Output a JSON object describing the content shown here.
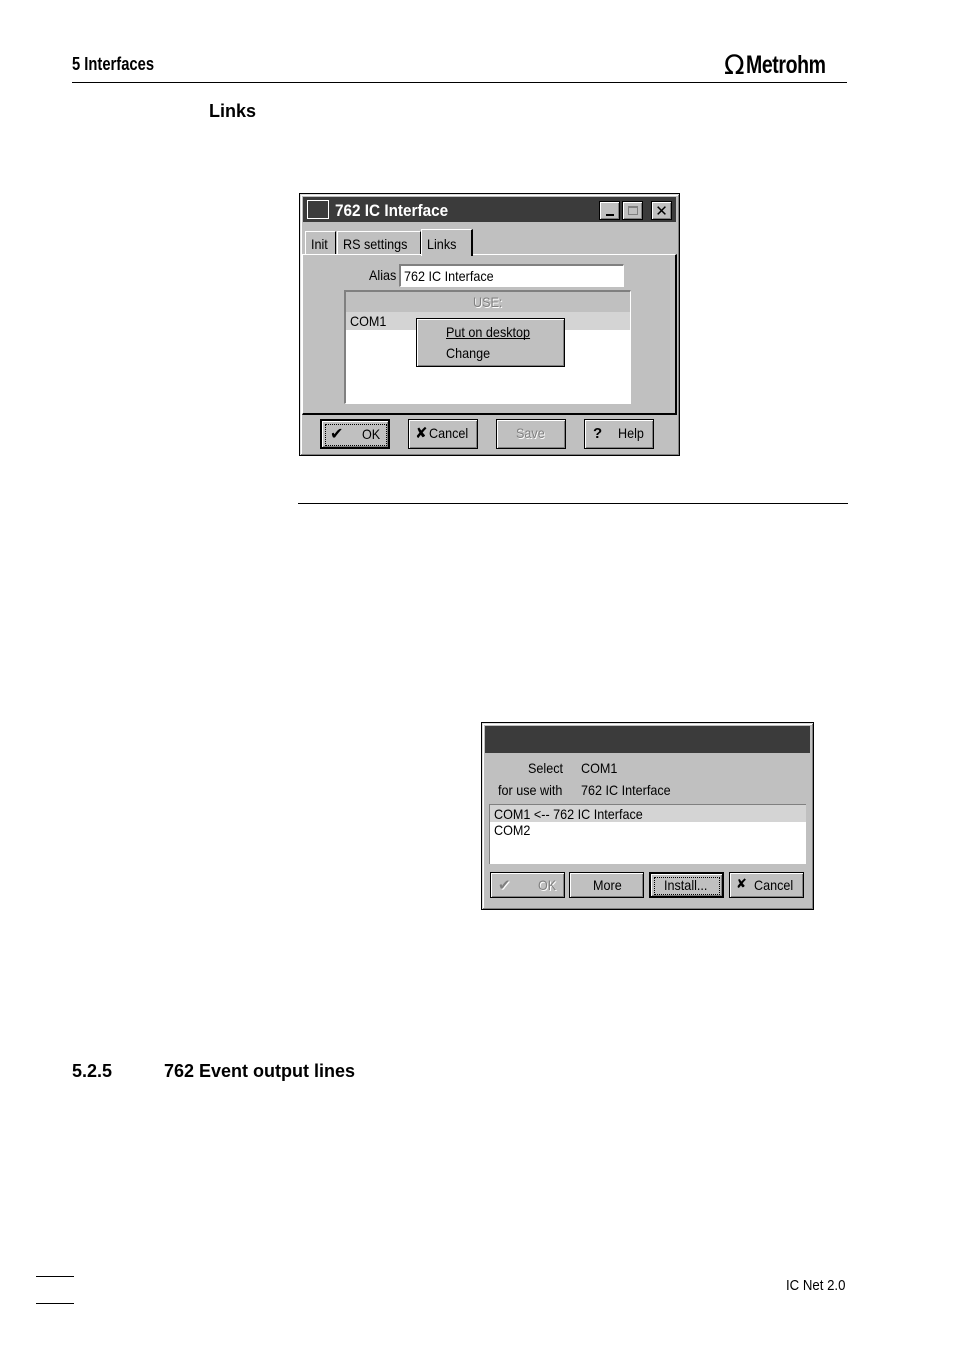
{
  "header": {
    "section": "5  Interfaces",
    "logo_text": "Metrohm"
  },
  "side_heading": "Links",
  "dialog1": {
    "title": "762 IC Interface",
    "tabs": [
      "Init",
      "RS settings",
      "Links"
    ],
    "alias_label": "Alias",
    "alias_value": "762 IC Interface",
    "list_header": "USE:",
    "list_row": "COM1",
    "context_menu": [
      "Put on desktop",
      "Change"
    ],
    "buttons": {
      "ok": "OK",
      "cancel": "Cancel",
      "save": "Save",
      "help": "Help"
    }
  },
  "dialog2": {
    "select_label": "Select",
    "select_value": "COM1",
    "use_with_label": "for use with",
    "use_with_value": "762 IC Interface",
    "list_items": [
      "COM1 <-- 762 IC Interface",
      "COM2"
    ],
    "buttons": {
      "ok": "OK",
      "more": "More",
      "install": "Install...",
      "cancel": "Cancel"
    }
  },
  "subsection": {
    "number": "5.2.5",
    "title": "762 Event output lines"
  },
  "footer": {
    "product": "IC Net 2.0"
  }
}
